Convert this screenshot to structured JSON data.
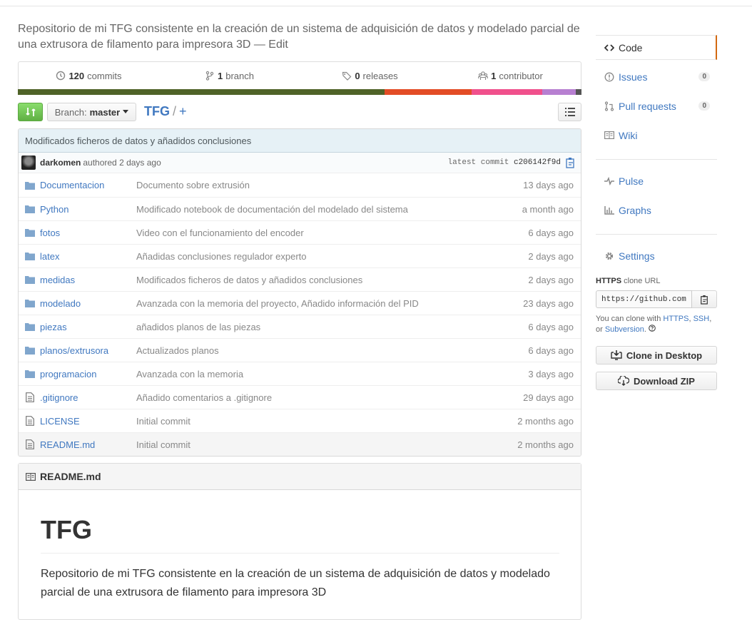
{
  "repo": {
    "description": "Repositorio de mi TFG consistente en la creación de un sistema de adquisición de datos y modelado parcial de una extrusora de filamento para impresora 3D",
    "desc_sep": " — ",
    "edit_label": "Edit"
  },
  "summary": {
    "commits_count": "120",
    "commits_label": "commits",
    "branches_count": "1",
    "branches_label": "branch",
    "releases_count": "0",
    "releases_label": "releases",
    "contributors_count": "1",
    "contributors_label": "contributor"
  },
  "language_bar": [
    {
      "color": "#4f6328",
      "percent": 65
    },
    {
      "color": "#e34c26",
      "percent": 15.5
    },
    {
      "color": "#f0508c",
      "percent": 12.5
    },
    {
      "color": "#b77fd1",
      "percent": 6
    },
    {
      "color": "#555555",
      "percent": 1
    }
  ],
  "file_nav": {
    "branch_label": "Branch:",
    "branch_name": "master",
    "repo_name": "TFG",
    "path_sep": "/",
    "plus": "+"
  },
  "latest_commit": {
    "message": "Modificados ficheros de datos y añadidos conclusiones",
    "author": "darkomen",
    "action": "authored 2 days ago",
    "latest_label": "latest commit",
    "sha": "c206142f9d"
  },
  "files": [
    {
      "type": "dir",
      "name": "Documentacion",
      "message": "Documento sobre extrusión",
      "age": "13 days ago"
    },
    {
      "type": "dir",
      "name": "Python",
      "message": "Modificado notebook de documentación del modelado del sistema",
      "age": "a month ago"
    },
    {
      "type": "dir",
      "name": "fotos",
      "message": "Video con el funcionamiento del encoder",
      "age": "6 days ago"
    },
    {
      "type": "dir",
      "name": "latex",
      "message": "Añadidas conclusiones regulador experto",
      "age": "2 days ago"
    },
    {
      "type": "dir",
      "name": "medidas",
      "message": "Modificados ficheros de datos y añadidos conclusiones",
      "age": "2 days ago"
    },
    {
      "type": "dir",
      "name": "modelado",
      "message": "Avanzada con la memoria del proyecto, Añadido información del PID",
      "age": "23 days ago"
    },
    {
      "type": "dir",
      "name": "piezas",
      "message": "añadidos planos de las piezas",
      "age": "6 days ago"
    },
    {
      "type": "dir",
      "name": "planos/extrusora",
      "message": "Actualizados planos",
      "age": "6 days ago"
    },
    {
      "type": "dir",
      "name": "programacion",
      "message": "Avanzada con la memoria",
      "age": "3 days ago"
    },
    {
      "type": "file",
      "name": ".gitignore",
      "message": "Añadido comentarios a .gitignore",
      "age": "29 days ago"
    },
    {
      "type": "file",
      "name": "LICENSE",
      "message": "Initial commit",
      "age": "2 months ago"
    },
    {
      "type": "file",
      "name": "README.md",
      "message": "Initial commit",
      "age": "2 months ago"
    }
  ],
  "readme": {
    "filename": "README.md",
    "heading": "TFG",
    "body": "Repositorio de mi TFG consistente en la creación de un sistema de adquisición de datos y modelado parcial de una extrusora de filamento para impresora 3D"
  },
  "sidebar": {
    "code": "Code",
    "issues": "Issues",
    "issues_count": "0",
    "pulls": "Pull requests",
    "pulls_count": "0",
    "wiki": "Wiki",
    "pulse": "Pulse",
    "graphs": "Graphs",
    "settings": "Settings"
  },
  "clone": {
    "protocol": "HTTPS",
    "title_rest": "clone URL",
    "url": "https://github.com/darkomen/TFG.git",
    "help_prefix": "You can clone with ",
    "https": "HTTPS",
    "comma": ", ",
    "ssh": "SSH",
    "or": ", or ",
    "subversion": "Subversion",
    "dot": ".",
    "desktop_label": "Clone in Desktop",
    "zip_label": "Download ZIP"
  }
}
